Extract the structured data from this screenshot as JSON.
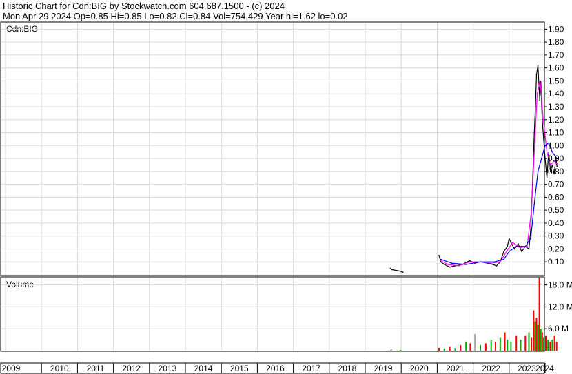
{
  "header": {
    "line1": "Historic Chart for Cdn:BIG by Stockwatch.com 604.687.1500 - (c) 2024",
    "line2": "Mon Apr 29 2024   Op=0.85  Hi=0.85  Lo=0.82  Cl=0.84  Vol=754,429  Year hi=1.62  lo=0.02"
  },
  "colors": {
    "price": "#000000",
    "ma_short": "#ff00ff",
    "ma_long": "#0000ff",
    "volume_up": "#ff0000",
    "volume_down": "#00aa00",
    "volume_gray": "#a0a0a0",
    "grid": "#d8d8d8"
  },
  "chart_data": [
    {
      "type": "line",
      "label": "Cdn:BIG",
      "y_axis_side": "right",
      "ylim": [
        0,
        1.95
      ],
      "yticks": [
        "0.10",
        "0.20",
        "0.30",
        "0.40",
        "0.50",
        "0.60",
        "0.70",
        "0.80",
        "0.90",
        "1.00",
        "1.10",
        "1.20",
        "1.30",
        "1.40",
        "1.50",
        "1.60",
        "1.70",
        "1.80",
        "1.90"
      ],
      "x_categories": [
        "2009",
        "2010",
        "2011",
        "2012",
        "2013",
        "2014",
        "2015",
        "2016",
        "2017",
        "2018",
        "2019",
        "2020",
        "2021",
        "2022",
        "2023",
        "2024"
      ],
      "grid": true,
      "series": [
        {
          "style": "price",
          "x": [
            2019.7,
            2019.75,
            2019.95,
            2020.05,
            2021.05,
            2021.1,
            2021.2,
            2021.35,
            2021.5,
            2021.7,
            2021.9,
            2022.05,
            2022.2,
            2022.4,
            2022.55,
            2022.65,
            2022.75,
            2022.85,
            2022.95,
            2023.0,
            2023.05,
            2023.15,
            2023.25,
            2023.35,
            2023.45,
            2023.55,
            2023.6,
            2023.65,
            2023.7,
            2023.73,
            2023.76,
            2023.8,
            2023.85,
            2023.88,
            2023.92,
            2023.96,
            2024.0,
            2024.05,
            2024.1,
            2024.15,
            2024.2,
            2024.25,
            2024.3,
            2024.33
          ],
          "y": [
            0.05,
            0.04,
            0.03,
            0.02,
            0.15,
            0.1,
            0.08,
            0.06,
            0.07,
            0.08,
            0.11,
            0.09,
            0.1,
            0.09,
            0.08,
            0.07,
            0.1,
            0.18,
            0.22,
            0.28,
            0.25,
            0.2,
            0.24,
            0.18,
            0.22,
            0.2,
            0.35,
            0.7,
            1.1,
            1.3,
            1.55,
            1.62,
            1.35,
            1.5,
            1.2,
            1.05,
            0.9,
            0.75,
            0.95,
            0.8,
            0.85,
            0.78,
            0.9,
            0.84
          ]
        },
        {
          "style": "ma_short",
          "x": [
            2021.1,
            2021.3,
            2021.6,
            2021.9,
            2022.2,
            2022.5,
            2022.75,
            2022.95,
            2023.1,
            2023.3,
            2023.5,
            2023.62,
            2023.7,
            2023.78,
            2023.86,
            2023.95,
            2024.05,
            2024.15,
            2024.25,
            2024.33
          ],
          "y": [
            0.11,
            0.08,
            0.07,
            0.1,
            0.1,
            0.09,
            0.1,
            0.19,
            0.25,
            0.21,
            0.22,
            0.5,
            0.95,
            1.4,
            1.5,
            1.2,
            0.95,
            0.85,
            0.88,
            0.86
          ]
        },
        {
          "style": "ma_long",
          "x": [
            2021.1,
            2021.4,
            2021.8,
            2022.2,
            2022.6,
            2022.85,
            2023.0,
            2023.2,
            2023.45,
            2023.6,
            2023.7,
            2023.8,
            2023.9,
            2024.0,
            2024.1,
            2024.2,
            2024.33
          ],
          "y": [
            0.12,
            0.09,
            0.08,
            0.1,
            0.1,
            0.12,
            0.18,
            0.22,
            0.22,
            0.28,
            0.55,
            0.8,
            0.9,
            1.0,
            1.02,
            0.95,
            0.9
          ]
        }
      ]
    },
    {
      "type": "bar",
      "label": "Volume",
      "y_axis_side": "right",
      "ylim": [
        0,
        20000000
      ],
      "yticks": [
        "6.0 M",
        "12.0 M",
        "18.0 M"
      ],
      "x_categories": [
        "2009",
        "2010",
        "2011",
        "2012",
        "2013",
        "2014",
        "2015",
        "2016",
        "2017",
        "2018",
        "2019",
        "2020",
        "2021",
        "2022",
        "2023",
        "2024"
      ],
      "series": [
        {
          "name": "Volume",
          "x": [
            2019.72,
            2019.98,
            2021.05,
            2021.2,
            2021.35,
            2021.5,
            2021.65,
            2021.8,
            2021.92,
            2022.05,
            2022.2,
            2022.35,
            2022.5,
            2022.62,
            2022.75,
            2022.88,
            2022.95,
            2023.05,
            2023.2,
            2023.32,
            2023.45,
            2023.55,
            2023.62,
            2023.68,
            2023.72,
            2023.76,
            2023.8,
            2023.84,
            2023.88,
            2023.92,
            2023.96,
            2024.02,
            2024.08,
            2024.14,
            2024.2,
            2024.26,
            2024.32
          ],
          "values": [
            300000,
            200000,
            800000,
            600000,
            1000000,
            700000,
            1500000,
            2500000,
            2000000,
            4500000,
            1500000,
            2000000,
            3000000,
            2500000,
            3500000,
            5000000,
            3000000,
            2500000,
            4000000,
            3000000,
            4000000,
            5000000,
            3500000,
            11000000,
            8000000,
            9000000,
            7000000,
            20000000,
            6000000,
            5000000,
            3500000,
            4000000,
            3000000,
            2500000,
            3000000,
            4000000,
            2500000
          ],
          "colors": [
            "volume_down",
            "volume_down",
            "volume_up",
            "volume_down",
            "volume_up",
            "volume_down",
            "volume_up",
            "volume_down",
            "volume_up",
            "volume_gray",
            "volume_down",
            "volume_up",
            "volume_down",
            "volume_up",
            "volume_down",
            "volume_up",
            "volume_down",
            "volume_down",
            "volume_up",
            "volume_down",
            "volume_up",
            "volume_down",
            "volume_up",
            "volume_up",
            "volume_down",
            "volume_up",
            "volume_down",
            "volume_up",
            "volume_down",
            "volume_up",
            "volume_down",
            "volume_up",
            "volume_down",
            "volume_up",
            "volume_down",
            "volume_up",
            "volume_up"
          ]
        }
      ]
    }
  ]
}
